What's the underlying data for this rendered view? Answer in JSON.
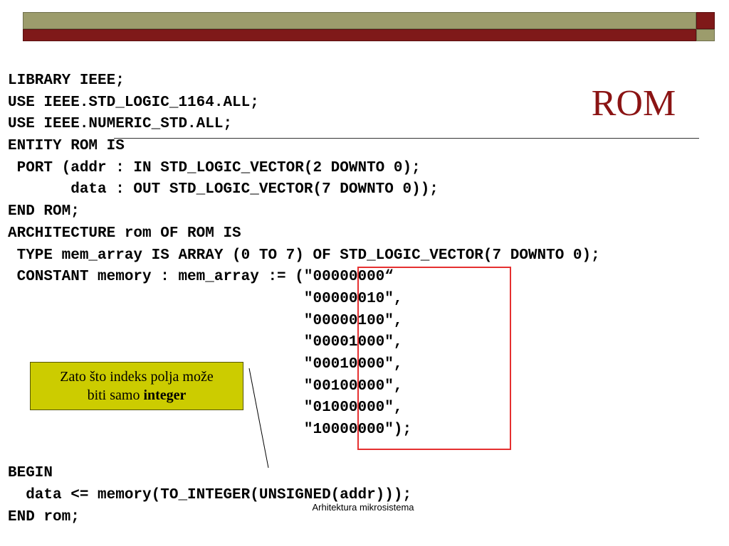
{
  "slide": {
    "title": "ROM",
    "footer": "Arhitektura mikrosistema"
  },
  "code_lines": [
    "LIBRARY IEEE;",
    "USE IEEE.STD_LOGIC_1164.ALL;",
    "USE IEEE.NUMERIC_STD.ALL;",
    "ENTITY ROM IS",
    " PORT (addr : IN STD_LOGIC_VECTOR(2 DOWNTO 0);",
    "       data : OUT STD_LOGIC_VECTOR(7 DOWNTO 0));",
    "END ROM;",
    "ARCHITECTURE rom OF ROM IS",
    " TYPE mem_array IS ARRAY (0 TO 7) OF STD_LOGIC_VECTOR(7 DOWNTO 0);",
    " CONSTANT memory : mem_array := (\"00000000“",
    "                                 \"00000010\",",
    "                                 \"00000100\",",
    "                                 \"00001000\",",
    "                                 \"00010000\",",
    "                                 \"00100000\",",
    "                                 \"01000000\",",
    "                                 \"10000000\");",
    "",
    "BEGIN",
    "  data <= memory(TO_INTEGER(UNSIGNED(addr)));",
    "END rom;"
  ],
  "note": {
    "text_line1": "Zato što indeks polja može",
    "text_line2_prefix": "biti samo ",
    "text_line2_bold": "integer"
  },
  "colors": {
    "title": "#8b1414",
    "header_olive": "#9c9c6c",
    "header_red": "#7f1919",
    "note_background": "#cccc00",
    "highlight_box": "#e53030"
  }
}
